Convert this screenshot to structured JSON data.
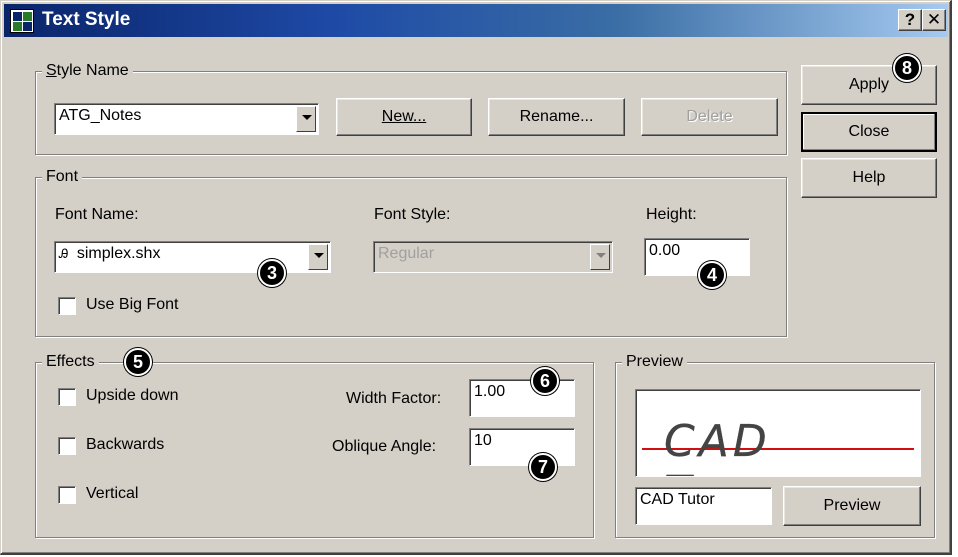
{
  "window": {
    "title": "Text Style",
    "help_glyph": "?",
    "close_glyph": "✕"
  },
  "style_name": {
    "group_label": "Style Name",
    "selected": "ATG_Notes",
    "new_label": "New...",
    "rename_label": "Rename...",
    "delete_label": "Delete"
  },
  "side_buttons": {
    "apply_label": "Apply",
    "close_label": "Close",
    "help_label": "Help"
  },
  "font": {
    "group_label": "Font",
    "font_name_label": "Font Name:",
    "font_name_value": "simplex.shx",
    "font_style_label": "Font Style:",
    "font_style_value": "Regular",
    "height_label": "Height:",
    "height_value": "0.00",
    "use_big_font_label": "Use Big Font",
    "use_big_font_checked": false
  },
  "effects": {
    "group_label": "Effects",
    "upside_down_label": "Upside down",
    "backwards_label": "Backwards",
    "vertical_label": "Vertical",
    "width_factor_label": "Width Factor:",
    "width_factor_value": "1.00",
    "oblique_angle_label": "Oblique Angle:",
    "oblique_angle_value": "10"
  },
  "preview": {
    "group_label": "Preview",
    "rendered_text": "CAD Tutor",
    "input_value": "CAD Tutor",
    "button_label": "Preview"
  },
  "callouts": [
    "3",
    "4",
    "5",
    "6",
    "7",
    "8"
  ],
  "colors": {
    "title_bar_start": "#0a246a",
    "title_bar_end": "#a6caf0",
    "dialog_face": "#d4d0c8",
    "preview_baseline": "#d01010",
    "callout_badge": "#000000"
  }
}
